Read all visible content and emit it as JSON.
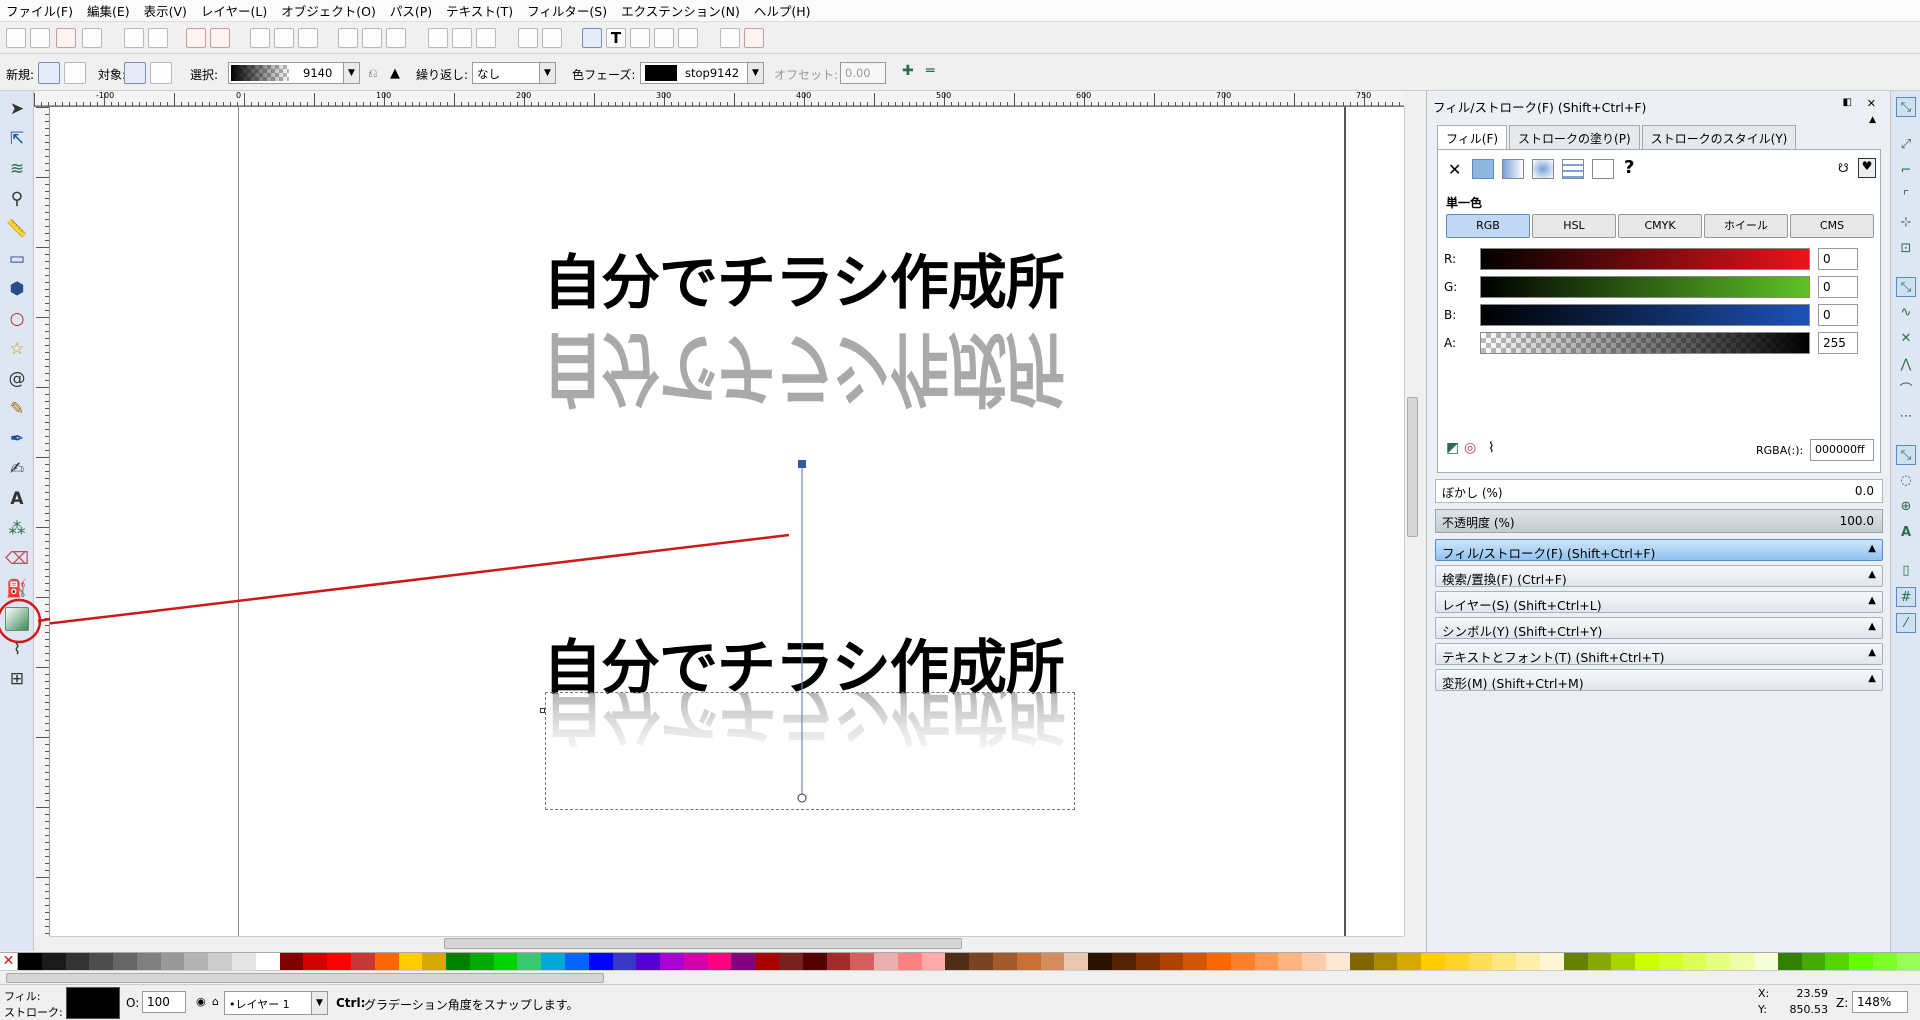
{
  "menu": [
    "ファイル(F)",
    "編集(E)",
    "表示(V)",
    "レイヤー(L)",
    "オブジェクト(O)",
    "パス(P)",
    "テキスト(T)",
    "フィルター(S)",
    "エクステンション(N)",
    "ヘルプ(H)"
  ],
  "ctrl": {
    "new_label": "新規:",
    "target_label": "対象:",
    "select_label": "選択:",
    "gradient_id": "9140",
    "repeat_label": "繰り返し:",
    "repeat_value": "なし",
    "stops_label": "色フェーズ:",
    "stop_id": "stop9142",
    "offset_label": "オフセット:",
    "offset_value": "0.00"
  },
  "canvas": {
    "headline": "自分でチラシ作成所",
    "reflection": "自分でチラシ作成所",
    "ruler_ticks": [
      "-100",
      "0",
      "100",
      "200",
      "300",
      "400",
      "500",
      "600",
      "700",
      "750"
    ]
  },
  "panel": {
    "title": "フィル/ストローク(F) (Shift+Ctrl+F)",
    "tabs": [
      "フィル(F)",
      "ストロークの塗り(P)",
      "ストロークのスタイル(Y)"
    ],
    "unknown_glyph": "?",
    "flat_label": "単一色",
    "modes": [
      "RGB",
      "HSL",
      "CMYK",
      "ホイール",
      "CMS"
    ],
    "channels": [
      {
        "name": "R:",
        "value": "0"
      },
      {
        "name": "G:",
        "value": "0"
      },
      {
        "name": "B:",
        "value": "0"
      },
      {
        "name": "A:",
        "value": "255"
      }
    ],
    "rgba_label": "RGBA(:):",
    "rgba_value": "000000ff",
    "blur_label": "ぼかし (%)",
    "blur_value": "0.0",
    "opacity_label": "不透明度 (%)",
    "opacity_value": "100.0",
    "docks": [
      "フィル/ストローク(F) (Shift+Ctrl+F)",
      "検索/置換(F) (Ctrl+F)",
      "レイヤー(S) (Shift+Ctrl+L)",
      "シンボル(Y) (Shift+Ctrl+Y)",
      "テキストとフォント(T) (Shift+Ctrl+T)",
      "変形(M) (Shift+Ctrl+M)"
    ]
  },
  "status": {
    "fill_label": "フィル:",
    "stroke_label": "ストローク:",
    "o_label": "O:",
    "opacity": "100",
    "layer": "•レイヤー 1",
    "message_key": "Ctrl:",
    "message": " グラデーション角度をスナップします。",
    "x_label": "X:",
    "x": "23.59",
    "y_label": "Y:",
    "y": "850.53",
    "z_label": "Z:",
    "zoom": "148%"
  },
  "colors": {
    "accent": "#3a79c9",
    "annotation_red": "#d01818",
    "reflection_gray": "#a9a9a9",
    "palette": [
      "#000000",
      "#1a1a1a",
      "#333333",
      "#4d4d4d",
      "#666666",
      "#808080",
      "#999999",
      "#b3b3b3",
      "#cccccc",
      "#e6e6e6",
      "#ffffff",
      "#800000",
      "#d40000",
      "#ff0000",
      "#c83737",
      "#ff6600",
      "#ffcc00",
      "#d4aa00",
      "#008000",
      "#00aa00",
      "#00d400",
      "#37c871",
      "#00aad4",
      "#0066ff",
      "#0000ff",
      "#3737c8",
      "#5500d4",
      "#aa00d4",
      "#d400aa",
      "#ff0080",
      "#800080",
      "#aa0000",
      "#782121",
      "#550000",
      "#a02c2c",
      "#d35f5f",
      "#e9afaf",
      "#ff8080",
      "#ffaaaa",
      "#502d16",
      "#784421",
      "#a05a2c",
      "#c87137",
      "#d38d5f",
      "#e9c6af",
      "#2b1100",
      "#552200",
      "#803300",
      "#aa4400",
      "#d45500",
      "#ff6600",
      "#ff7f2a",
      "#ff9955",
      "#ffb380",
      "#ffccaa",
      "#ffe6d5",
      "#806600",
      "#aa8800",
      "#d4aa00",
      "#ffcc00",
      "#ffd42a",
      "#ffdd55",
      "#ffe680",
      "#ffeeaa",
      "#fff6d5",
      "#668000",
      "#88aa00",
      "#aad400",
      "#ccff00",
      "#d4ff2a",
      "#ddff55",
      "#e5ff80",
      "#eeffaa",
      "#f6ffd5",
      "#338000",
      "#44aa00",
      "#55d400",
      "#66ff00",
      "#7fff2a",
      "#99ff55"
    ]
  }
}
